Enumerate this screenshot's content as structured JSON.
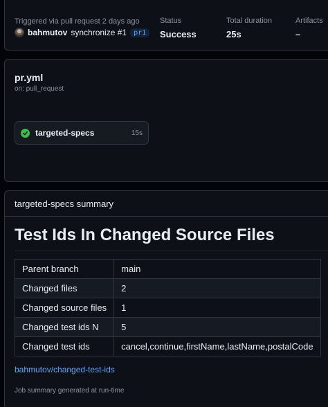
{
  "run_summary": {
    "trigger_text": "Triggered via pull request 2 days ago",
    "actor": "bahmutov",
    "event": "synchronize #1",
    "pr_badge": "pr1",
    "status_label": "Status",
    "status_value": "Success",
    "duration_label": "Total duration",
    "duration_value": "25s",
    "artifacts_label": "Artifacts",
    "artifacts_value": "–"
  },
  "workflow": {
    "file": "pr.yml",
    "trigger": "on: pull_request",
    "jobs": [
      {
        "name": "targeted-specs",
        "duration": "15s",
        "status": "success"
      }
    ]
  },
  "job_summary": {
    "header": "targeted-specs summary",
    "title": "Test Ids In Changed Source Files",
    "rows": [
      {
        "key": "Parent branch",
        "value": "main"
      },
      {
        "key": "Changed files",
        "value": "2"
      },
      {
        "key": "Changed source files",
        "value": "1"
      },
      {
        "key": "Changed test ids N",
        "value": "5"
      },
      {
        "key": "Changed test ids",
        "value": "cancel,continue,firstName,lastName,postalCode"
      }
    ],
    "link_text": "bahmutov/changed-test-ids",
    "footer": "Job summary generated at run-time"
  },
  "colors": {
    "background": "#010409",
    "card": "#0d1117",
    "border": "#30363d",
    "link": "#58a6ff",
    "success": "#3fb950",
    "muted_text": "#8b949e"
  },
  "icons": [
    "avatar",
    "check-circle-icon"
  ]
}
